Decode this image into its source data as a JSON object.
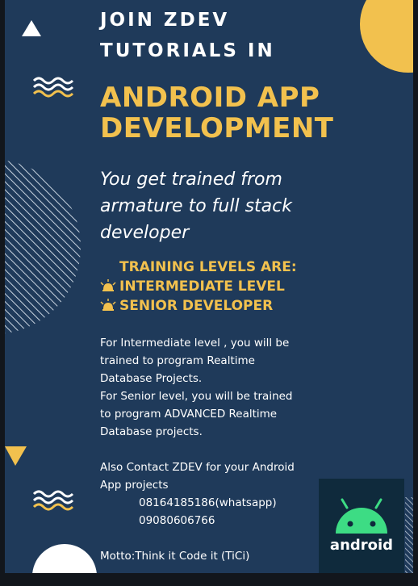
{
  "headline": {
    "line1": "JOIN ZDEV",
    "line2": "TUTORIALS IN"
  },
  "title": {
    "line1": "ANDROID APP",
    "line2": "DEVELOPMENT"
  },
  "tagline": {
    "line1": "You get  trained from",
    "line2": "armature to full stack",
    "line3": "developer"
  },
  "levels": {
    "heading": "TRAINING LEVELS ARE:",
    "items": [
      "INTERMEDIATE LEVEL",
      "SENIOR DEVELOPER"
    ]
  },
  "details": {
    "lines": [
      "For Intermediate level ,  you will be",
      "trained to program Realtime",
      "Database Projects.",
      "For Senior level,  you will be trained",
      "to program ADVANCED Realtime",
      "Database projects."
    ]
  },
  "contact": {
    "line1": "Also Contact ZDEV for your Android",
    "line2": "App  projects",
    "phone1": "08164185186(whatsapp)",
    "phone2": "09080606766"
  },
  "motto": "Motto:Think it Code it (TiCi)",
  "android_logo": {
    "label": "android"
  },
  "colors": {
    "background": "#1f3a5a",
    "accent_yellow": "#f2c14e",
    "text": "#ffffff",
    "android_green": "#3ddc84",
    "logo_box": "#0f2a3c"
  }
}
